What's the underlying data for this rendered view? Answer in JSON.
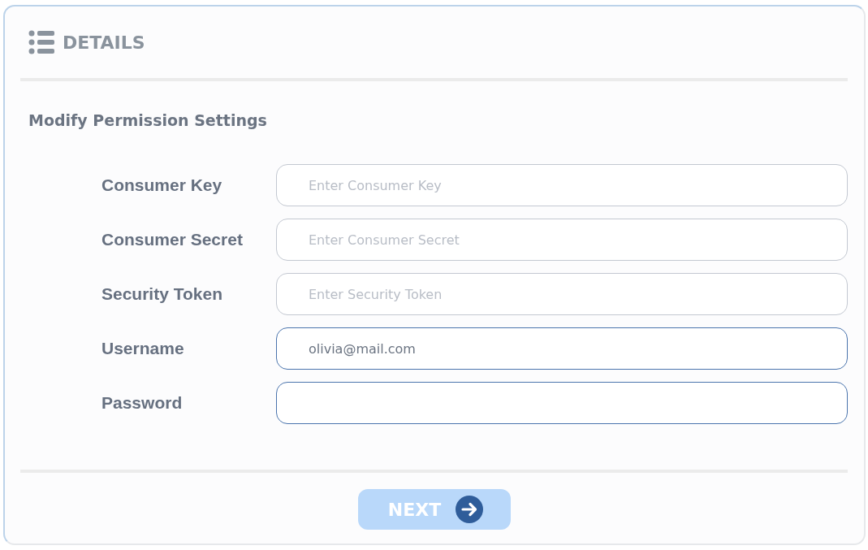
{
  "header": {
    "title": "DETAILS"
  },
  "subtitle": "Modify Permission Settings",
  "fields": [
    {
      "label": "Consumer Key",
      "placeholder": "Enter Consumer Key",
      "focused": false
    },
    {
      "label": "Consumer Secret",
      "placeholder": "Enter Consumer Secret",
      "focused": false
    },
    {
      "label": "Security Token",
      "placeholder": "Enter Security Token",
      "focused": false
    },
    {
      "label": "Username",
      "value": "olivia@mail.com",
      "focused": true
    },
    {
      "label": "Password",
      "focused": true
    }
  ],
  "next_button": {
    "label": "NEXT",
    "disabled": true
  }
}
